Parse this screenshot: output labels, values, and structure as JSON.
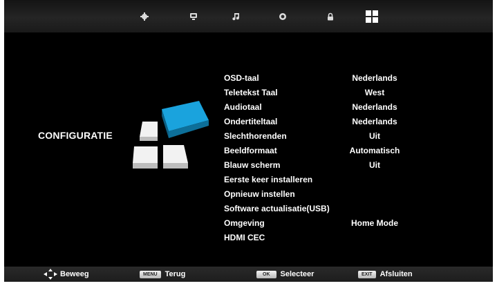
{
  "top_nav": {
    "icons": [
      {
        "name": "picture-settings-icon"
      },
      {
        "name": "tv-screen-icon"
      },
      {
        "name": "music-note-icon"
      },
      {
        "name": "clock-icon"
      },
      {
        "name": "lock-icon"
      },
      {
        "name": "setup-grid-icon",
        "active": true
      }
    ]
  },
  "page": {
    "title": "CONFIGURATIE"
  },
  "menu": {
    "items": [
      {
        "label": "OSD-taal",
        "value": "Nederlands"
      },
      {
        "label": "Teletekst Taal",
        "value": "West"
      },
      {
        "label": "Audiotaal",
        "value": "Nederlands"
      },
      {
        "label": "Ondertiteltaal",
        "value": "Nederlands"
      },
      {
        "label": "Slechthorenden",
        "value": "Uit"
      },
      {
        "label": "Beeldformaat",
        "value": "Automatisch"
      },
      {
        "label": "Blauw scherm",
        "value": "Uit"
      },
      {
        "label": "Eerste keer installeren",
        "value": ""
      },
      {
        "label": "Opnieuw instellen",
        "value": ""
      },
      {
        "label": "Software actualisatie(USB)",
        "value": ""
      },
      {
        "label": "Omgeving",
        "value": "Home Mode"
      },
      {
        "label": "HDMI CEC",
        "value": ""
      }
    ]
  },
  "footer": {
    "move": {
      "icon": "dpad-arrows-icon",
      "label": "Beweeg"
    },
    "back": {
      "key": "MENU",
      "label": "Terug"
    },
    "select": {
      "key": "OK",
      "label": "Selecteer"
    },
    "exit": {
      "key": "EXIT",
      "label": "Afsluiten"
    }
  },
  "colors": {
    "accent": "#1aa3dd",
    "background": "#000000",
    "text": "#ffffff"
  }
}
